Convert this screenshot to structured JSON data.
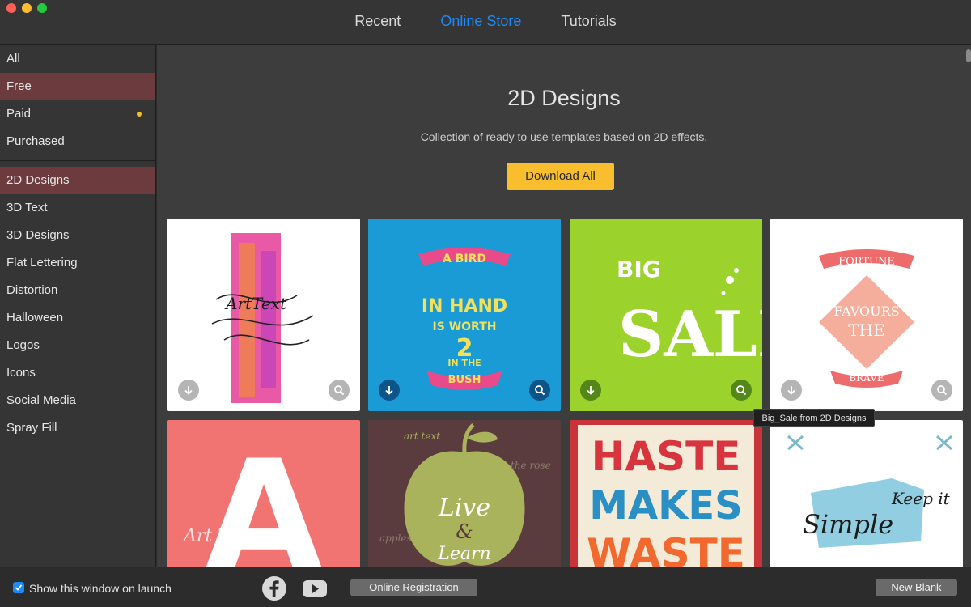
{
  "window": {
    "tabs": [
      {
        "label": "Recent"
      },
      {
        "label": "Online Store",
        "active": true
      },
      {
        "label": "Tutorials"
      }
    ]
  },
  "sidebar": {
    "filters": [
      {
        "label": "All"
      },
      {
        "label": "Free",
        "selected": true
      },
      {
        "label": "Paid",
        "badge": "dot"
      },
      {
        "label": "Purchased"
      }
    ],
    "categories": [
      {
        "label": "2D Designs",
        "selected": true
      },
      {
        "label": "3D Text"
      },
      {
        "label": "3D Designs"
      },
      {
        "label": "Flat Lettering"
      },
      {
        "label": "Distortion"
      },
      {
        "label": "Halloween"
      },
      {
        "label": "Logos"
      },
      {
        "label": "Icons"
      },
      {
        "label": "Social Media"
      },
      {
        "label": "Spray Fill"
      }
    ]
  },
  "main": {
    "title": "2D Designs",
    "description": "Collection of ready to use templates based on 2D effects.",
    "download_all_label": "Download All",
    "tooltip": "Big_Sale from 2D Designs",
    "templates": [
      {
        "texts": [
          "ArtText"
        ],
        "bg": "#ffffff"
      },
      {
        "texts": [
          "A BIRD",
          "IN HAND",
          "IS WORTH",
          "2",
          "IN THE",
          "BUSH"
        ],
        "bg": "#1b9bd6"
      },
      {
        "texts": [
          "BIG",
          "SALE"
        ],
        "bg": "#9bd22b"
      },
      {
        "texts": [
          "FORTUNE",
          "FAVOURS",
          "THE",
          "BRAVE"
        ],
        "bg": "#ffffff"
      },
      {
        "texts": [
          "A",
          "Art Text"
        ],
        "bg": "#f06478"
      },
      {
        "texts": [
          "Live",
          "&",
          "Learn",
          "art text",
          "apples",
          "the rose"
        ],
        "bg": "#5a3c3e"
      },
      {
        "texts": [
          "HASTE",
          "MAKES",
          "WASTE"
        ],
        "bg": "#f3ead7"
      },
      {
        "texts": [
          "Keep it",
          "Simple"
        ],
        "bg": "#ffffff"
      }
    ]
  },
  "footer": {
    "show_on_launch_label": "Show this window on launch",
    "show_on_launch_checked": true,
    "registration_label": "Online Registration",
    "new_blank_label": "New Blank"
  },
  "colors": {
    "accent": "#1b8bfb",
    "selected_row": "#6b3b3e",
    "primary_button": "#f8be2e",
    "paid_badge": "#f5bd26"
  }
}
